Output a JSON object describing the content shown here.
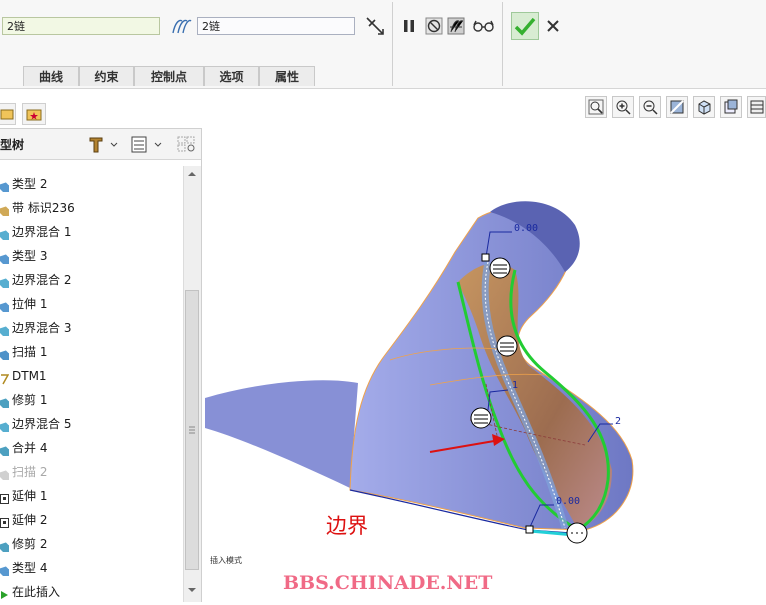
{
  "dashboard": {
    "field1_value": "2链",
    "field2_value": "2链",
    "tabs": [
      "曲线",
      "约束",
      "控制点",
      "选项",
      "属性"
    ]
  },
  "tree": {
    "title": "型树",
    "items": [
      {
        "label": "类型 2",
        "icon": "blend-icon",
        "dim": false
      },
      {
        "label": "带 标识236",
        "icon": "ribbon-icon",
        "dim": false
      },
      {
        "label": "边界混合 1",
        "icon": "boundary-blend-icon",
        "dim": false
      },
      {
        "label": "类型 3",
        "icon": "blend-icon",
        "dim": false
      },
      {
        "label": "边界混合 2",
        "icon": "boundary-blend-icon",
        "dim": false
      },
      {
        "label": "拉伸 1",
        "icon": "extrude-icon",
        "dim": false
      },
      {
        "label": "边界混合 3",
        "icon": "boundary-blend-icon",
        "dim": false
      },
      {
        "label": "扫描 1",
        "icon": "sweep-icon",
        "dim": false
      },
      {
        "label": "DTM1",
        "icon": "datum-plane-icon",
        "dim": false
      },
      {
        "label": "修剪 1",
        "icon": "trim-icon",
        "dim": false
      },
      {
        "label": "边界混合 5",
        "icon": "boundary-blend-icon",
        "dim": false
      },
      {
        "label": "合并 4",
        "icon": "merge-icon",
        "dim": false
      },
      {
        "label": "扫描 2",
        "icon": "sweep-icon",
        "dim": true
      },
      {
        "label": "延伸 1",
        "icon": "extend-icon",
        "dim": false
      },
      {
        "label": "延伸 2",
        "icon": "extend-icon",
        "dim": false
      },
      {
        "label": "修剪 2",
        "icon": "trim-icon",
        "dim": false
      },
      {
        "label": "类型 4",
        "icon": "blend-icon",
        "dim": false
      },
      {
        "label": "在此插入",
        "icon": "insert-arrow-icon",
        "dim": false
      }
    ]
  },
  "viewport": {
    "insert_mode_label": "插入模式",
    "boundary_label": "边界",
    "watermark": "BBS.CHINADE.NET",
    "annotations": [
      "0.00",
      "1",
      "2",
      "0.00"
    ]
  },
  "colors": {
    "surface": "#8d95d8",
    "highlight_green": "#22cc33",
    "label_red": "#dd1111",
    "ok_green": "#35b02f"
  }
}
